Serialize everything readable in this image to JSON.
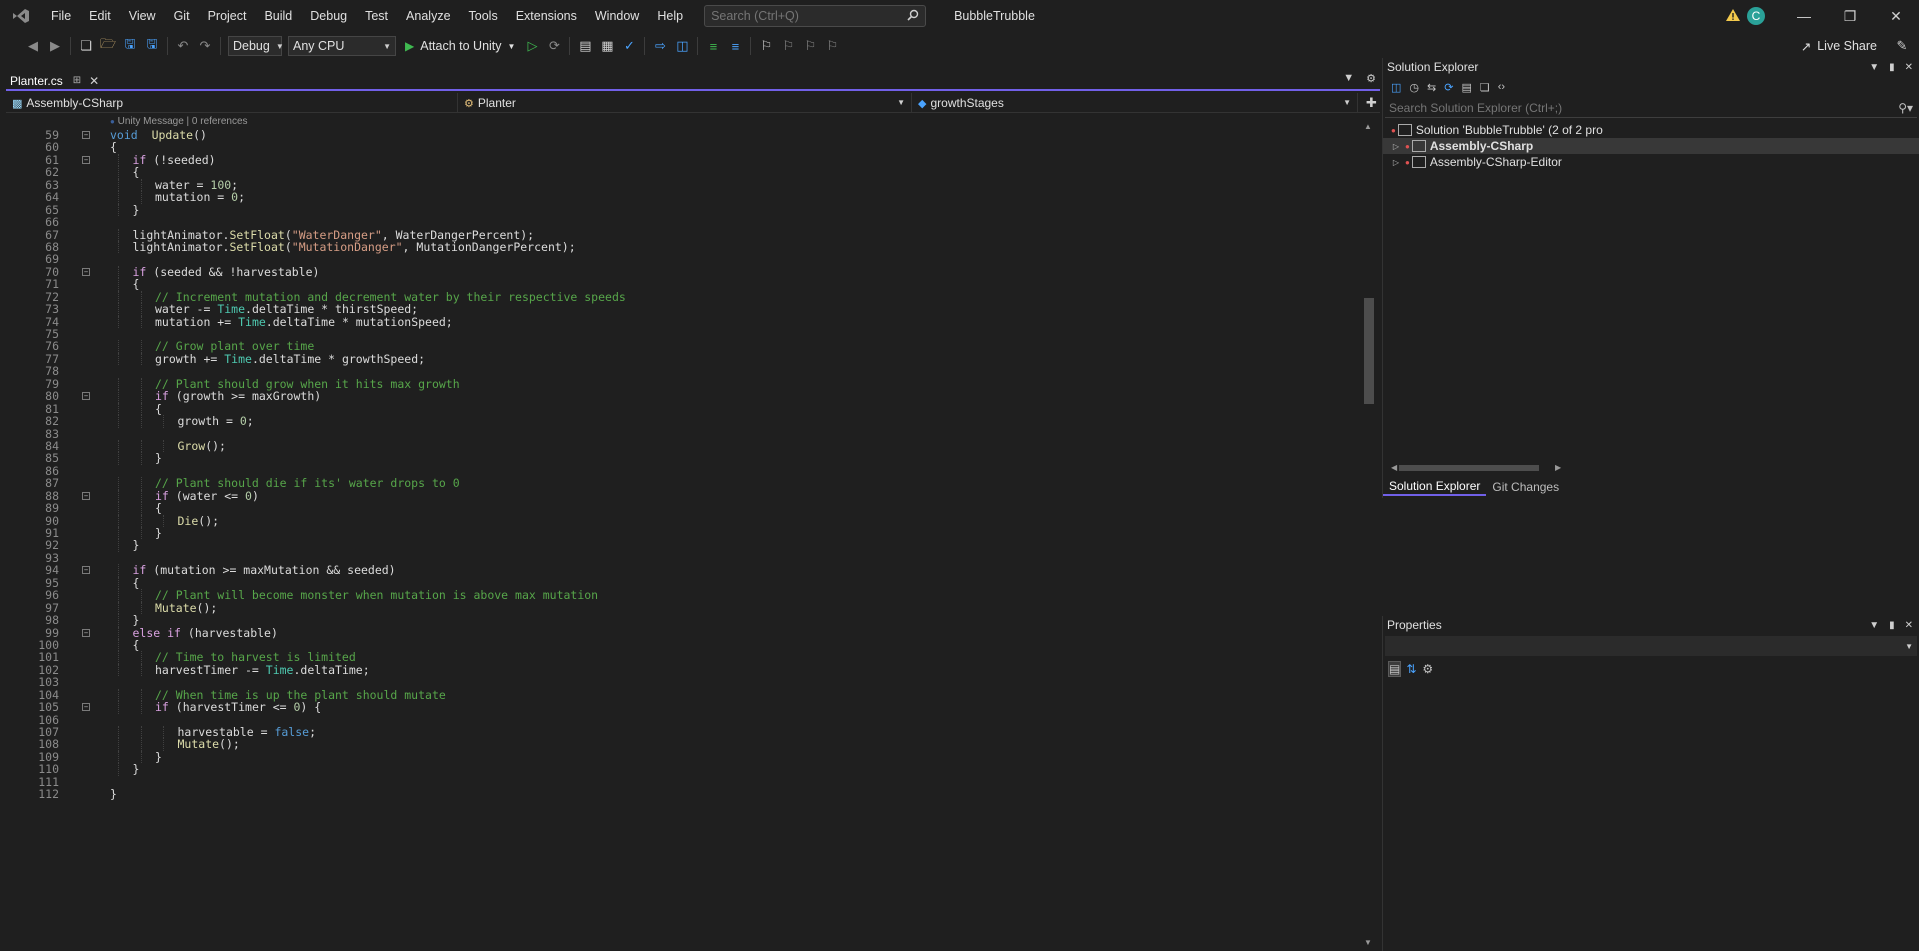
{
  "titlebar": {
    "menus": [
      "File",
      "Edit",
      "View",
      "Git",
      "Project",
      "Build",
      "Debug",
      "Test",
      "Analyze",
      "Tools",
      "Extensions",
      "Window",
      "Help"
    ],
    "search_placeholder": "Search (Ctrl+Q)",
    "solution_name": "BubbleTrubble",
    "account_initial": "C"
  },
  "toolbar": {
    "configuration": "Debug",
    "platform": "Any CPU",
    "attach_label": "Attach to Unity",
    "live_share": "Live Share"
  },
  "editor": {
    "tab_title": "Planter.cs",
    "nav_project": "Assembly-CSharp",
    "nav_type": "Planter",
    "nav_member": "growthStages",
    "codelens": "Unity Message | 0 references",
    "lines": [
      {
        "n": "59",
        "fold": "⊟",
        "indent": 0,
        "tokens": [
          [
            "kw",
            "void"
          ],
          [
            "",
            "  "
          ],
          [
            "fn",
            "Update"
          ],
          [
            "",
            "()"
          ]
        ]
      },
      {
        "n": "60",
        "indent": 0,
        "tokens": [
          [
            "",
            "{"
          ]
        ]
      },
      {
        "n": "61",
        "fold": "⊟",
        "indent": 1,
        "tokens": [
          [
            "ctl",
            "if"
          ],
          [
            "",
            " (!seeded)"
          ]
        ]
      },
      {
        "n": "62",
        "indent": 1,
        "tokens": [
          [
            "",
            "{"
          ]
        ]
      },
      {
        "n": "63",
        "indent": 2,
        "tokens": [
          [
            "",
            "water = "
          ],
          [
            "num",
            "100"
          ],
          [
            "",
            ";"
          ]
        ]
      },
      {
        "n": "64",
        "indent": 2,
        "tokens": [
          [
            "",
            "mutation = "
          ],
          [
            "num",
            "0"
          ],
          [
            "",
            ";"
          ]
        ]
      },
      {
        "n": "65",
        "indent": 1,
        "tokens": [
          [
            "",
            "}"
          ]
        ]
      },
      {
        "n": "66",
        "indent": 0,
        "tokens": []
      },
      {
        "n": "67",
        "indent": 1,
        "tokens": [
          [
            "",
            "lightAnimator."
          ],
          [
            "fn",
            "SetFloat"
          ],
          [
            "",
            "("
          ],
          [
            "str",
            "\"WaterDanger\""
          ],
          [
            "",
            ", WaterDangerPercent);"
          ]
        ]
      },
      {
        "n": "68",
        "indent": 1,
        "tokens": [
          [
            "",
            "lightAnimator."
          ],
          [
            "fn",
            "SetFloat"
          ],
          [
            "",
            "("
          ],
          [
            "str",
            "\"MutationDanger\""
          ],
          [
            "",
            ", MutationDangerPercent);"
          ]
        ]
      },
      {
        "n": "69",
        "indent": 0,
        "tokens": []
      },
      {
        "n": "70",
        "fold": "⊟",
        "indent": 1,
        "tokens": [
          [
            "ctl",
            "if"
          ],
          [
            "",
            " (seeded && !harvestable)"
          ]
        ]
      },
      {
        "n": "71",
        "indent": 1,
        "tokens": [
          [
            "",
            "{"
          ]
        ]
      },
      {
        "n": "72",
        "indent": 2,
        "tokens": [
          [
            "cmt",
            "// Increment mutation and decrement water by their respective speeds"
          ]
        ]
      },
      {
        "n": "73",
        "indent": 2,
        "tokens": [
          [
            "",
            "water -= "
          ],
          [
            "cls",
            "Time"
          ],
          [
            "",
            ".deltaTime * thirstSpeed;"
          ]
        ]
      },
      {
        "n": "74",
        "indent": 2,
        "tokens": [
          [
            "",
            "mutation += "
          ],
          [
            "cls",
            "Time"
          ],
          [
            "",
            ".deltaTime * mutationSpeed;"
          ]
        ]
      },
      {
        "n": "75",
        "indent": 0,
        "tokens": []
      },
      {
        "n": "76",
        "indent": 2,
        "tokens": [
          [
            "cmt",
            "// Grow plant over time"
          ]
        ]
      },
      {
        "n": "77",
        "indent": 2,
        "tokens": [
          [
            "",
            "growth += "
          ],
          [
            "cls",
            "Time"
          ],
          [
            "",
            ".deltaTime * growthSpeed;"
          ]
        ]
      },
      {
        "n": "78",
        "indent": 0,
        "tokens": []
      },
      {
        "n": "79",
        "indent": 2,
        "tokens": [
          [
            "cmt",
            "// Plant should grow when it hits max growth"
          ]
        ]
      },
      {
        "n": "80",
        "fold": "⊟",
        "indent": 2,
        "tokens": [
          [
            "ctl",
            "if"
          ],
          [
            "",
            " (growth >= maxGrowth)"
          ]
        ]
      },
      {
        "n": "81",
        "indent": 2,
        "tokens": [
          [
            "",
            "{"
          ]
        ]
      },
      {
        "n": "82",
        "indent": 3,
        "tokens": [
          [
            "",
            "growth = "
          ],
          [
            "num",
            "0"
          ],
          [
            "",
            ";"
          ]
        ]
      },
      {
        "n": "83",
        "indent": 0,
        "tokens": []
      },
      {
        "n": "84",
        "indent": 3,
        "tokens": [
          [
            "fn",
            "Grow"
          ],
          [
            "",
            "();"
          ]
        ]
      },
      {
        "n": "85",
        "indent": 2,
        "tokens": [
          [
            "",
            "}"
          ]
        ]
      },
      {
        "n": "86",
        "indent": 0,
        "tokens": []
      },
      {
        "n": "87",
        "indent": 2,
        "tokens": [
          [
            "cmt",
            "// Plant should die if its' water drops to 0"
          ]
        ]
      },
      {
        "n": "88",
        "fold": "⊟",
        "indent": 2,
        "tokens": [
          [
            "ctl",
            "if"
          ],
          [
            "",
            " (water <= "
          ],
          [
            "num",
            "0"
          ],
          [
            "",
            ")"
          ]
        ]
      },
      {
        "n": "89",
        "indent": 2,
        "tokens": [
          [
            "",
            "{"
          ]
        ]
      },
      {
        "n": "90",
        "indent": 3,
        "tokens": [
          [
            "fn",
            "Die"
          ],
          [
            "",
            "();"
          ]
        ]
      },
      {
        "n": "91",
        "indent": 2,
        "tokens": [
          [
            "",
            "}"
          ]
        ]
      },
      {
        "n": "92",
        "indent": 1,
        "tokens": [
          [
            "",
            "}"
          ]
        ]
      },
      {
        "n": "93",
        "indent": 0,
        "tokens": []
      },
      {
        "n": "94",
        "fold": "⊟",
        "indent": 1,
        "tokens": [
          [
            "ctl",
            "if"
          ],
          [
            "",
            " (mutation >= maxMutation && seeded)"
          ]
        ]
      },
      {
        "n": "95",
        "indent": 1,
        "tokens": [
          [
            "",
            "{"
          ]
        ]
      },
      {
        "n": "96",
        "indent": 2,
        "tokens": [
          [
            "cmt",
            "// Plant will become monster when mutation is above max mutation"
          ]
        ]
      },
      {
        "n": "97",
        "indent": 2,
        "tokens": [
          [
            "fn",
            "Mutate"
          ],
          [
            "",
            "();"
          ]
        ]
      },
      {
        "n": "98",
        "indent": 1,
        "tokens": [
          [
            "",
            "}"
          ]
        ]
      },
      {
        "n": "99",
        "fold": "⊟",
        "indent": 1,
        "tokens": [
          [
            "ctl",
            "else if"
          ],
          [
            "",
            " (harvestable)"
          ]
        ]
      },
      {
        "n": "100",
        "indent": 1,
        "tokens": [
          [
            "",
            "{"
          ]
        ]
      },
      {
        "n": "101",
        "indent": 2,
        "tokens": [
          [
            "cmt",
            "// Time to harvest is limited"
          ]
        ]
      },
      {
        "n": "102",
        "indent": 2,
        "tokens": [
          [
            "",
            "harvestTimer -= "
          ],
          [
            "cls",
            "Time"
          ],
          [
            "",
            ".deltaTime;"
          ]
        ]
      },
      {
        "n": "103",
        "indent": 0,
        "tokens": []
      },
      {
        "n": "104",
        "indent": 2,
        "tokens": [
          [
            "cmt",
            "// When time is up the plant should mutate"
          ]
        ]
      },
      {
        "n": "105",
        "fold": "⊟",
        "indent": 2,
        "tokens": [
          [
            "ctl",
            "if"
          ],
          [
            "",
            " (harvestTimer <= "
          ],
          [
            "num",
            "0"
          ],
          [
            "",
            ") {"
          ]
        ]
      },
      {
        "n": "106",
        "indent": 0,
        "tokens": []
      },
      {
        "n": "107",
        "indent": 3,
        "tokens": [
          [
            "",
            "harvestable = "
          ],
          [
            "kw",
            "false"
          ],
          [
            "",
            ";"
          ]
        ]
      },
      {
        "n": "108",
        "indent": 3,
        "tokens": [
          [
            "fn",
            "Mutate"
          ],
          [
            "",
            "();"
          ]
        ]
      },
      {
        "n": "109",
        "indent": 2,
        "tokens": [
          [
            "",
            "}"
          ]
        ]
      },
      {
        "n": "110",
        "indent": 1,
        "tokens": [
          [
            "",
            "}"
          ]
        ]
      },
      {
        "n": "111",
        "indent": 0,
        "tokens": []
      },
      {
        "n": "112",
        "indent": 0,
        "tokens": [
          [
            "",
            "}"
          ]
        ]
      }
    ]
  },
  "solution_explorer": {
    "title": "Solution Explorer",
    "search_placeholder": "Search Solution Explorer (Ctrl+;)",
    "solution_label": "Solution 'BubbleTrubble' (2 of 2 pro",
    "projects": [
      "Assembly-CSharp",
      "Assembly-CSharp-Editor"
    ],
    "tabs": [
      "Solution Explorer",
      "Git Changes"
    ]
  },
  "properties": {
    "title": "Properties"
  },
  "colors": {
    "accent": "#7160e8",
    "background": "#1f1f1f",
    "keyword": "#569cd6",
    "control": "#d8a0df",
    "string": "#d69d85",
    "comment": "#57a64a",
    "class": "#4ec9b0",
    "method": "#dcdcaa",
    "number": "#b5cea8"
  },
  "icons": {
    "warning": "warning-icon",
    "play": "play-icon",
    "search": "search-icon"
  }
}
